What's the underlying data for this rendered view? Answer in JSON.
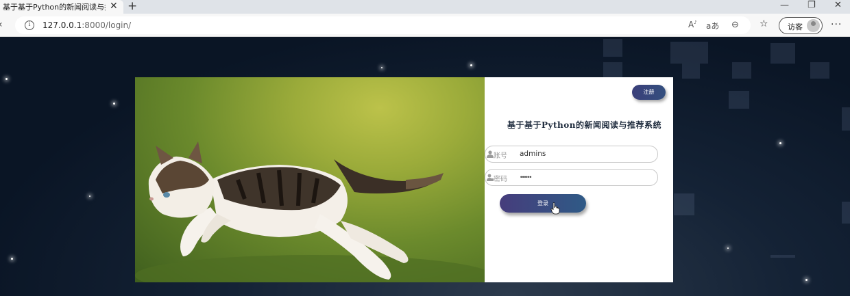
{
  "browser": {
    "tab_title": "基于基于Python的新闻阅读与推荐系统",
    "tab_close": "✕",
    "new_tab": "+",
    "url_host": "127.0.0.1",
    "url_rest": ":8000/login/",
    "guest_label": "访客"
  },
  "login": {
    "register_label": "注册",
    "title": "基于基于Python的新闻阅读与推荐系统",
    "account_label": "账号",
    "account_value": "admins",
    "password_label": "密码",
    "password_value": "••••••",
    "login_label": "登录"
  },
  "colors": {
    "button_start": "#463d7c",
    "button_end": "#2f5a86",
    "background": "#0b1626"
  }
}
